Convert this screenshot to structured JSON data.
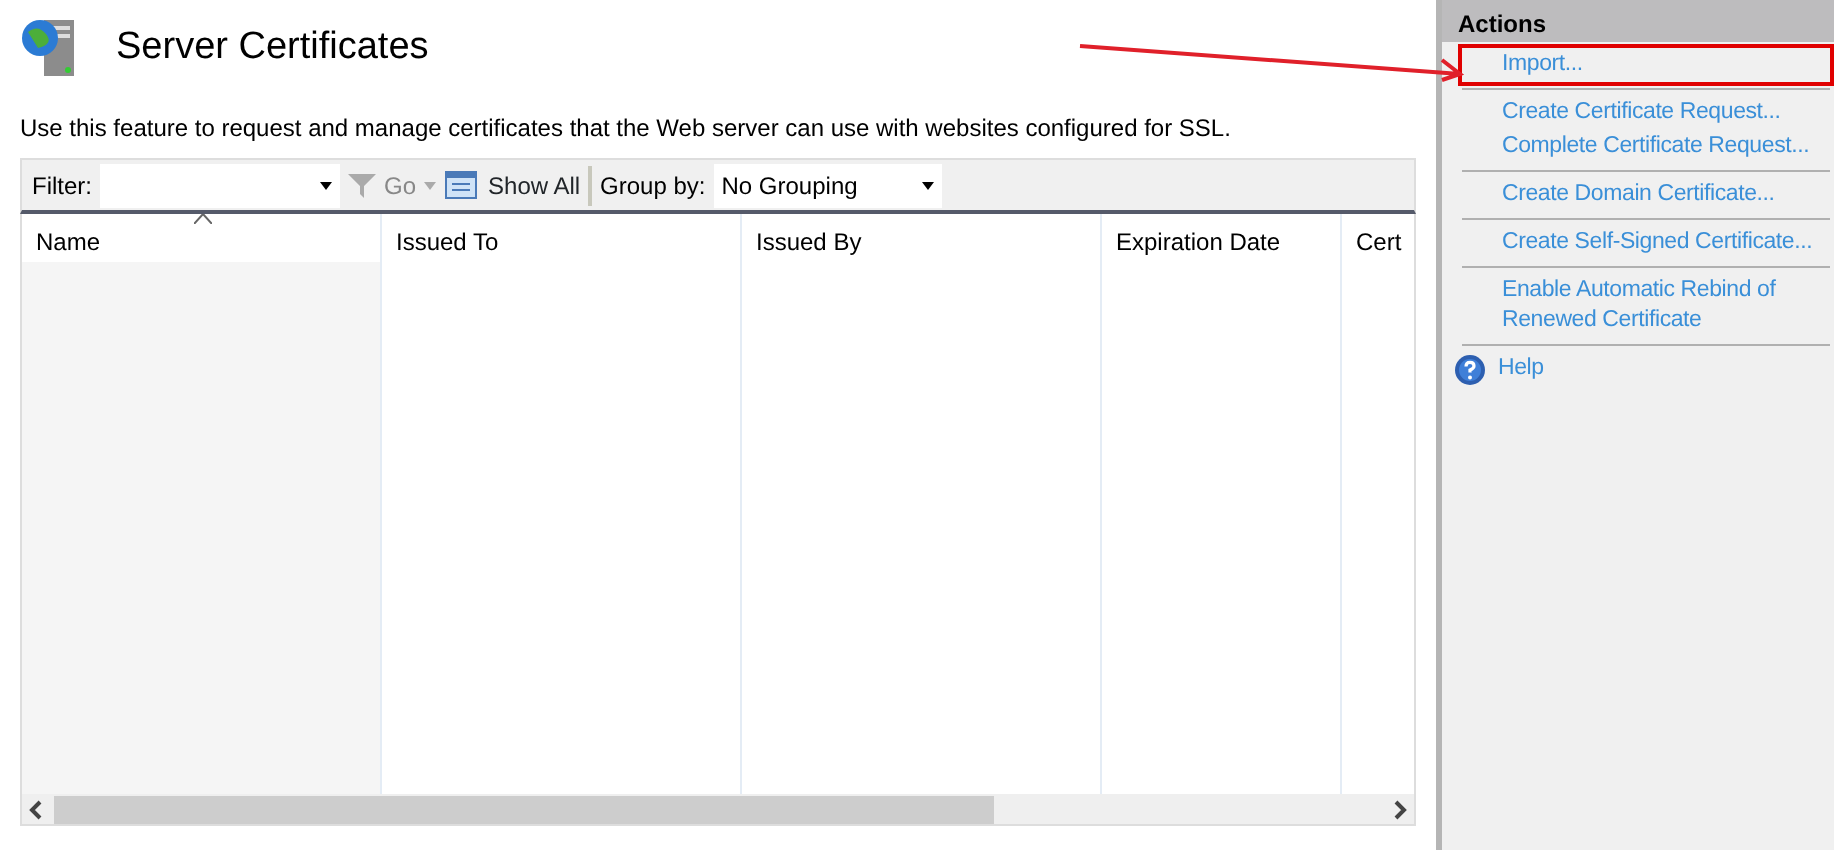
{
  "page": {
    "title": "Server Certificates",
    "description": "Use this feature to request and manage certificates that the Web server can use with websites configured for SSL."
  },
  "toolbar": {
    "filter_label": "Filter:",
    "go_label": "Go",
    "show_all_label": "Show All",
    "group_by_label": "Group by:",
    "group_by_value": "No Grouping"
  },
  "table": {
    "columns": [
      {
        "label": "Name",
        "sorted": true
      },
      {
        "label": "Issued To",
        "sorted": false
      },
      {
        "label": "Issued By",
        "sorted": false
      },
      {
        "label": "Expiration Date",
        "sorted": false
      },
      {
        "label": "Cert",
        "sorted": false
      }
    ]
  },
  "actions": {
    "title": "Actions",
    "groups": [
      [
        {
          "label": "Import...",
          "kind": "link",
          "highlighted": true
        }
      ],
      [
        {
          "label": "Create Certificate Request...",
          "kind": "link",
          "highlighted": false
        },
        {
          "label": "Complete Certificate Request...",
          "kind": "link",
          "highlighted": false
        }
      ],
      [
        {
          "label": "Create Domain Certificate...",
          "kind": "link",
          "highlighted": false
        }
      ],
      [
        {
          "label": "Create Self-Signed Certificate...",
          "kind": "link",
          "highlighted": false
        }
      ],
      [
        {
          "label": "Enable Automatic Rebind of Renewed Certificate",
          "kind": "link",
          "highlighted": false
        }
      ],
      [
        {
          "label": "Help",
          "kind": "help",
          "highlighted": false
        }
      ]
    ]
  }
}
